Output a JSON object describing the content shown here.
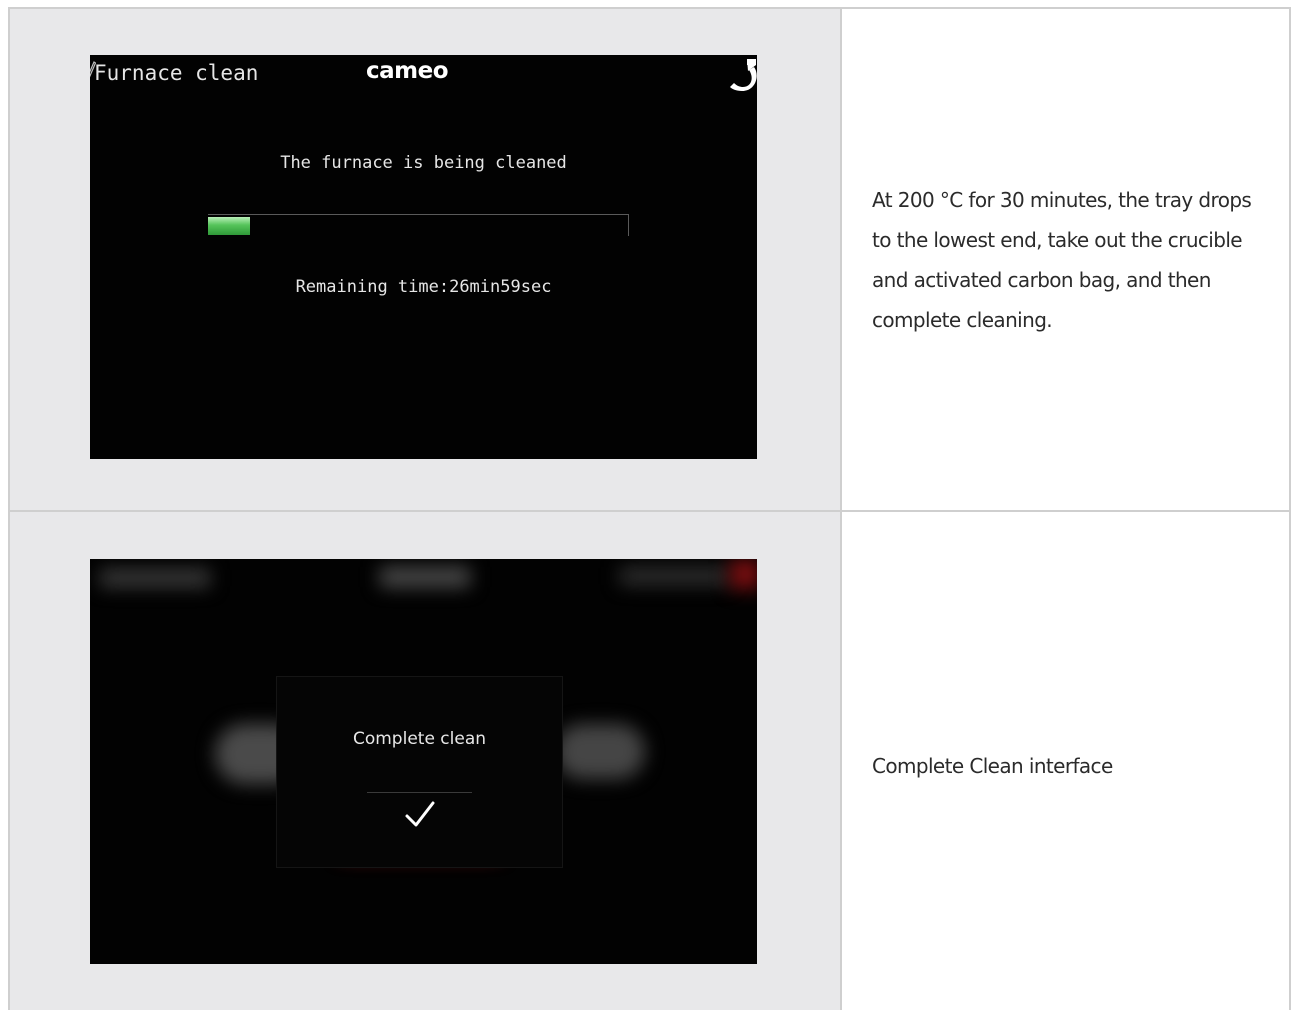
{
  "rows": [
    {
      "screen": {
        "header_title": "Furnace clean",
        "logo": "cameo",
        "status": "The furnace is being cleaned",
        "progress_fraction": 0.1,
        "remaining": "Remaining time:26min59sec",
        "back_icon": "back-arrow-icon",
        "edit_icon": "pencil-icon"
      },
      "description": "At 200 °C for 30 minutes, the tray drops to the lowest end, take out the crucible and activated carbon bag, and then complete cleaning."
    },
    {
      "screen": {
        "dialog_text": "Complete clean",
        "confirm_icon": "checkmark-icon"
      },
      "description": "Complete Clean interface"
    }
  ],
  "colors": {
    "cell_background": "#e8e8ea",
    "screen_background": "#020202",
    "progress_green": "#55c45a",
    "accent_red": "#c0141a"
  }
}
